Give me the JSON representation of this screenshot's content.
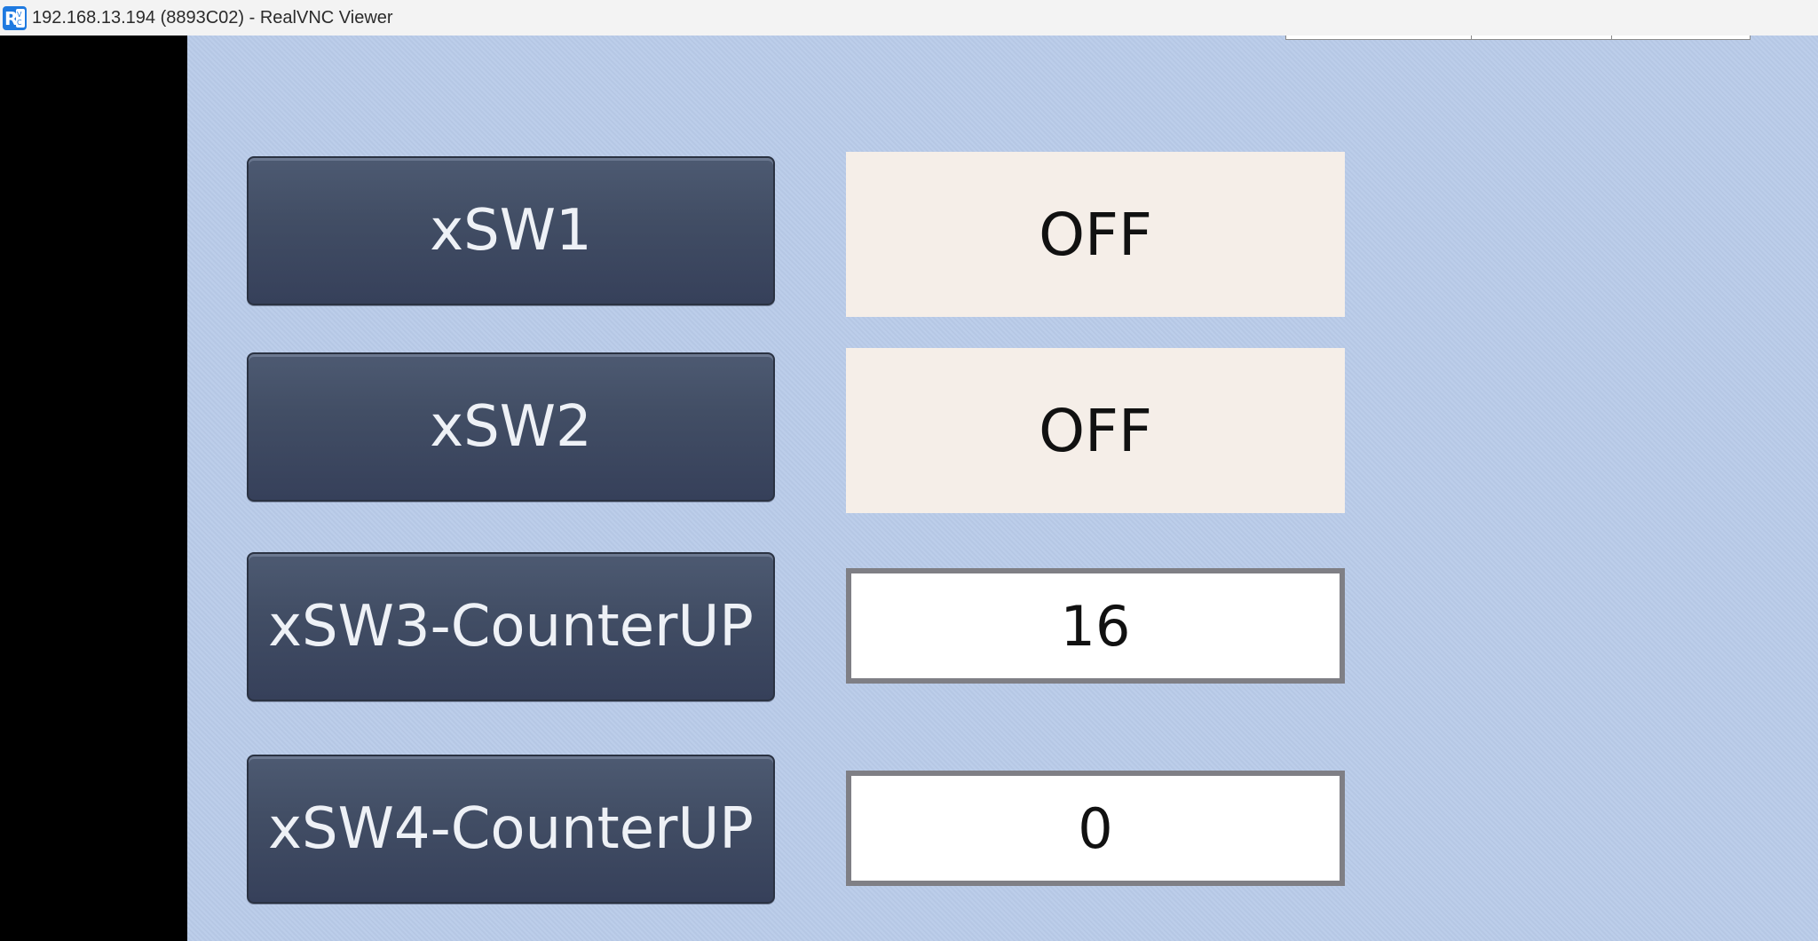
{
  "window": {
    "title": "192.168.13.194 (8893C02) - RealVNC Viewer",
    "app_icon": "realvnc-logo-icon"
  },
  "hmi": {
    "buttons": [
      {
        "label": "xSW1"
      },
      {
        "label": "xSW2"
      },
      {
        "label": "xSW3-CounterUP"
      },
      {
        "label": "xSW4-CounterUP"
      }
    ],
    "status_displays": [
      {
        "value": "OFF"
      },
      {
        "value": "OFF"
      }
    ],
    "counter_displays": [
      {
        "value": "16"
      },
      {
        "value": "0"
      }
    ]
  },
  "colors": {
    "background": "#b9cbe9",
    "button": "#424e65",
    "status_box": "#f5eee8",
    "counter_border": "#7f7f85"
  }
}
